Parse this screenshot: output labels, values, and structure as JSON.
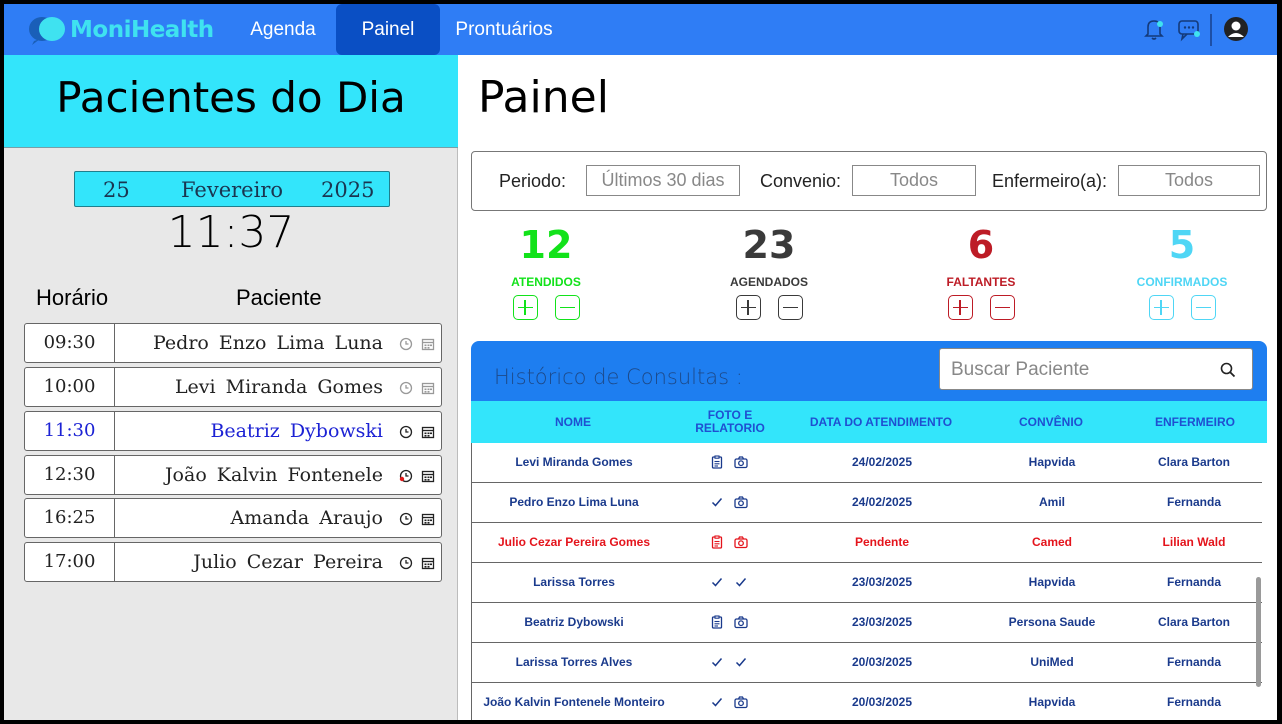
{
  "app": {
    "logo_text": "MoniHealth"
  },
  "nav": {
    "items": [
      "Agenda",
      "Painel",
      "Prontuários"
    ],
    "active": "Painel"
  },
  "left": {
    "title": "Pacientes do Dia",
    "date": {
      "day": "25",
      "month": "Fevereiro",
      "year": "2025"
    },
    "time": "11:37",
    "col_time": "Horário",
    "col_patient": "Paciente",
    "schedule": [
      {
        "time": "09:30",
        "name": "Pedro Enzo Lima Luna",
        "active": false
      },
      {
        "time": "10:00",
        "name": "Levi Miranda Gomes",
        "active": false
      },
      {
        "time": "11:30",
        "name": "Beatriz Dybowski",
        "active": true
      },
      {
        "time": "12:30",
        "name": "João Kalvin Fontenele",
        "active": false
      },
      {
        "time": "16:25",
        "name": "Amanda Araujo",
        "active": false
      },
      {
        "time": "17:00",
        "name": "Julio Cezar Pereira",
        "active": false
      }
    ]
  },
  "main": {
    "title": "Painel",
    "filters": {
      "period_label": "Periodo:",
      "period_value": "Últimos 30 dias",
      "insurance_label": "Convenio:",
      "insurance_value": "Todos",
      "nurse_label": "Enfermeiro(a):",
      "nurse_value": "Todos"
    },
    "stats": [
      {
        "value": "12",
        "label": "ATENDIDOS",
        "color": "#12e21a"
      },
      {
        "value": "23",
        "label": "AGENDADOS",
        "color": "#3a3a3a"
      },
      {
        "value": "6",
        "label": "FALTANTES",
        "color": "#bd1c26"
      },
      {
        "value": "5",
        "label": "CONFIRMADOS",
        "color": "#4fd6f5"
      }
    ],
    "history": {
      "title": "Histórico de Consultas :",
      "search_placeholder": "Buscar Paciente",
      "headers": [
        "NOME",
        "FOTO E RELATORIO",
        "DATA DO ATENDIMENTO",
        "CONVÊNIO",
        "ENFERMEIRO"
      ],
      "rows": [
        {
          "name": "Levi Miranda Gomes",
          "icons": [
            "clipboard-icon",
            "camera-icon"
          ],
          "date": "24/02/2025",
          "insurance": "Hapvida",
          "nurse": "Clara Barton",
          "pending": false
        },
        {
          "name": "Pedro Enzo Lima Luna",
          "icons": [
            "check-icon",
            "camera-icon"
          ],
          "date": "24/02/2025",
          "insurance": "Amil",
          "nurse": "Fernanda",
          "pending": false
        },
        {
          "name": "Julio Cezar Pereira Gomes",
          "icons": [
            "clipboard-icon",
            "camera-icon"
          ],
          "date": "Pendente",
          "insurance": "Camed",
          "nurse": "Lilian Wald",
          "pending": true
        },
        {
          "name": "Larissa Torres",
          "icons": [
            "check-icon",
            "check-icon"
          ],
          "date": "23/03/2025",
          "insurance": "Hapvida",
          "nurse": "Fernanda",
          "pending": false
        },
        {
          "name": "Beatriz Dybowski",
          "icons": [
            "clipboard-icon",
            "camera-icon"
          ],
          "date": "23/03/2025",
          "insurance": "Persona Saude",
          "nurse": "Clara Barton",
          "pending": false
        },
        {
          "name": "Larissa Torres Alves",
          "icons": [
            "check-icon",
            "check-icon"
          ],
          "date": "20/03/2025",
          "insurance": "UniMed",
          "nurse": "Fernanda",
          "pending": false
        },
        {
          "name": "João Kalvin Fontenele Monteiro",
          "icons": [
            "check-icon",
            "camera-icon"
          ],
          "date": "20/03/2025",
          "insurance": "Hapvida",
          "nurse": "Fernanda",
          "pending": false
        }
      ]
    }
  }
}
